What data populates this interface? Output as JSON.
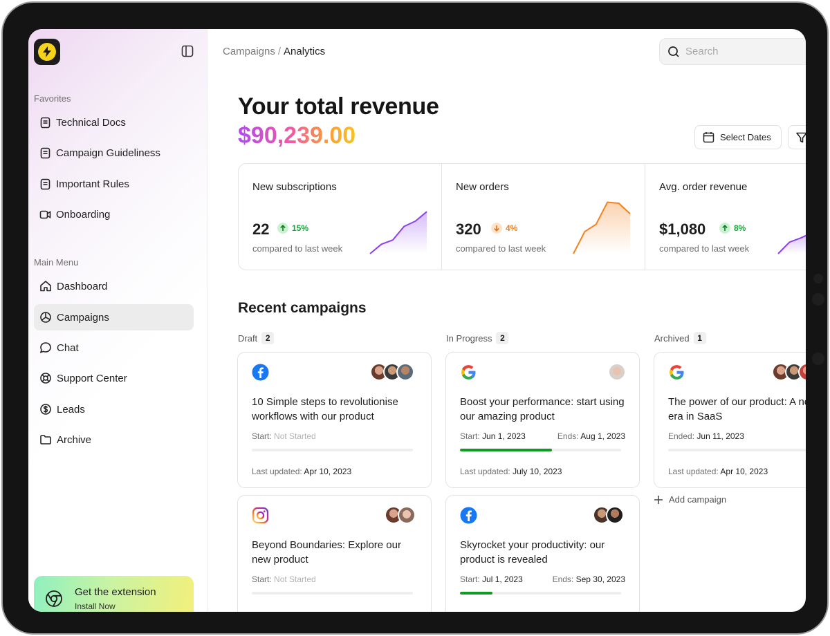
{
  "sidebar": {
    "favorites_label": "Favorites",
    "favorites": [
      {
        "label": "Technical Docs",
        "icon": "document-icon"
      },
      {
        "label": "Campaign Guideliness",
        "icon": "document-icon"
      },
      {
        "label": "Important Rules",
        "icon": "document-icon"
      },
      {
        "label": "Onboarding",
        "icon": "video-icon"
      }
    ],
    "main_menu_label": "Main Menu",
    "menu": [
      {
        "label": "Dashboard",
        "icon": "home-icon"
      },
      {
        "label": "Campaigns",
        "icon": "pie-chart-icon",
        "active": true
      },
      {
        "label": "Chat",
        "icon": "chat-bubble-icon"
      },
      {
        "label": "Support Center",
        "icon": "lifebuoy-icon"
      },
      {
        "label": "Leads",
        "icon": "dollar-circle-icon"
      },
      {
        "label": "Archive",
        "icon": "folder-icon"
      }
    ],
    "extension": {
      "title": "Get the extension",
      "subtitle": "Install Now",
      "icon": "chrome-icon"
    }
  },
  "header": {
    "breadcrumb": {
      "parent": "Campaigns",
      "separator": "/",
      "current": "Analytics"
    },
    "search_placeholder": "Search"
  },
  "revenue": {
    "title": "Your total revenue",
    "amount": "$90,239.00",
    "select_dates_label": "Select Dates"
  },
  "stats": [
    {
      "label": "New subscriptions",
      "value": "22",
      "delta": "15%",
      "trend": "up",
      "sub": "compared to last week",
      "color": "#8a3ff0",
      "delta_color": "#1aa33b",
      "delta_bg": "#c9f2cf",
      "series": [
        0,
        18,
        26,
        52,
        62,
        80
      ]
    },
    {
      "label": "New orders",
      "value": "320",
      "delta": "4%",
      "trend": "down",
      "sub": "compared to last week",
      "color": "#f4811f",
      "delta_color": "#f07f1b",
      "delta_bg": "#fde3c8",
      "series": [
        0,
        42,
        56,
        98,
        96,
        76
      ]
    },
    {
      "label": "Avg. order revenue",
      "value": "$1,080",
      "delta": "8%",
      "trend": "up",
      "sub": "compared to last week",
      "color": "#8a3ff0",
      "delta_color": "#1aa33b",
      "delta_bg": "#c9f2cf",
      "series": [
        0,
        22,
        30,
        40
      ]
    }
  ],
  "recent": {
    "title": "Recent campaigns",
    "columns": [
      {
        "label": "Draft",
        "count": "2"
      },
      {
        "label": "In Progress",
        "count": "2"
      },
      {
        "label": "Archived",
        "count": "1"
      }
    ],
    "cards": [
      {
        "brand": "facebook-icon",
        "title": "10 Simple steps to revolutionise workflows with our product",
        "start_label": "Start:",
        "start": "Not Started",
        "start_muted": true,
        "end_label": "",
        "end": "",
        "progress": 0,
        "updated_label": "Last updated:",
        "updated": "Apr 10, 2023",
        "avatars": 3
      },
      {
        "brand": "google-icon",
        "title": "Boost your performance: start using our amazing product",
        "start_label": "Start:",
        "start": "Jun 1, 2023",
        "start_muted": false,
        "end_label": "Ends:",
        "end": "Aug 1, 2023",
        "progress": 0.57,
        "updated_label": "Last updated:",
        "updated": "July 10, 2023",
        "avatars": 1
      },
      {
        "brand": "google-icon",
        "title": "The power of our product: A new era in SaaS",
        "start_label": "Ended:",
        "start": "Jun 11, 2023",
        "start_muted": false,
        "end_label": "",
        "end": "",
        "progress": 0,
        "updated_label": "Last updated:",
        "updated": "Apr 10, 2023",
        "avatars": 3
      },
      {
        "brand": "instagram-icon",
        "title": "Beyond Boundaries: Explore our new product",
        "start_label": "Start:",
        "start": "Not Started",
        "start_muted": true,
        "end_label": "",
        "end": "",
        "progress": 0,
        "updated_label": "",
        "updated": "",
        "avatars": 2
      },
      {
        "brand": "facebook-icon",
        "title": "Skyrocket your productivity: our product is revealed",
        "start_label": "Start:",
        "start": "Jul 1, 2023",
        "start_muted": false,
        "end_label": "Ends:",
        "end": "Sep 30, 2023",
        "progress": 0.2,
        "updated_label": "",
        "updated": "",
        "avatars": 2
      }
    ],
    "add_campaign_label": "Add campaign"
  }
}
